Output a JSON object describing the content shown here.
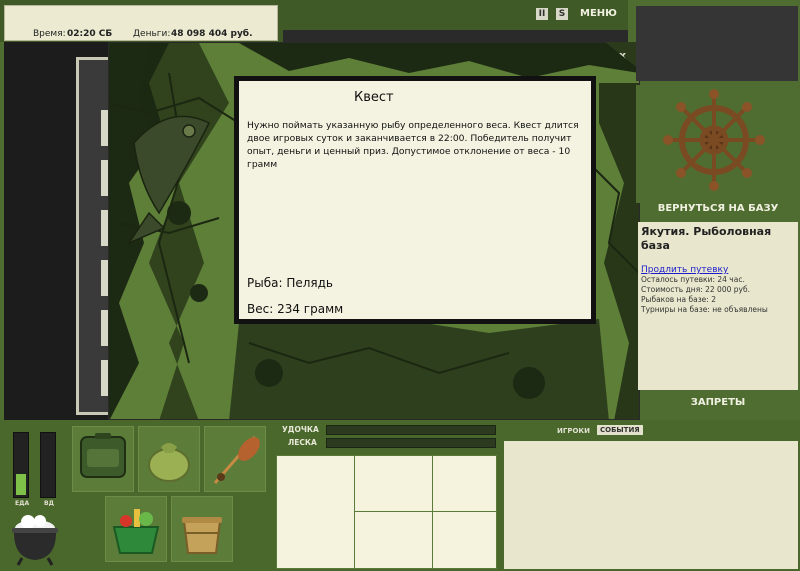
{
  "header": {
    "time_label": "Время:",
    "time_value": "02:20 СБ",
    "money_label": "Деньги:",
    "money_value": "48 098 404 руб.",
    "pause_btn": "II",
    "sound_btn": "S",
    "menu_label": "МЕНЮ"
  },
  "dialog": {
    "close": "x",
    "title": "Квест",
    "description": "Нужно поймать указанную рыбу определенного веса. Квест длится двое игровых суток и заканчивается в 22:00. Победитель получит опыт, деньги и ценный приз. Допустимое отклонение от веса - 10 грамм",
    "fish": "Рыба: Пелядь",
    "weight": "Вес: 234 грамм"
  },
  "sidebar": {
    "wheel_icon": "ship-wheel-icon",
    "back_to_base": "ВЕРНУТЬСЯ НА БАЗУ",
    "base_title": "Якутия. Рыболовная база",
    "extend_link": "Продлить путевку",
    "lines": [
      "Осталось путевки: 24 час.",
      "Стоимость дня: 22 000 руб.",
      "Рыбаков на базе: 2",
      "Турниры на базе: не объявлены"
    ],
    "bans": "ЗАПРЕТЫ"
  },
  "bottom": {
    "food_label": "ЕДА",
    "drink_label": "ВД",
    "food_level": 0.35,
    "drink_level": 0.0,
    "rod_label": "УДОЧКА",
    "line_label": "ЛЕСКА",
    "tabs": [
      "ИГРОКИ",
      "СОБЫТИЯ"
    ],
    "inventory_icons": [
      "backpack-icon",
      "sack-icon",
      "spoon-bait-icon",
      "grocery-basket-icon",
      "bucket-icon"
    ]
  },
  "colors": {
    "accent_green": "#7ec048",
    "panel_cream": "#f4f3e1",
    "link_blue": "#1d1dcc"
  }
}
